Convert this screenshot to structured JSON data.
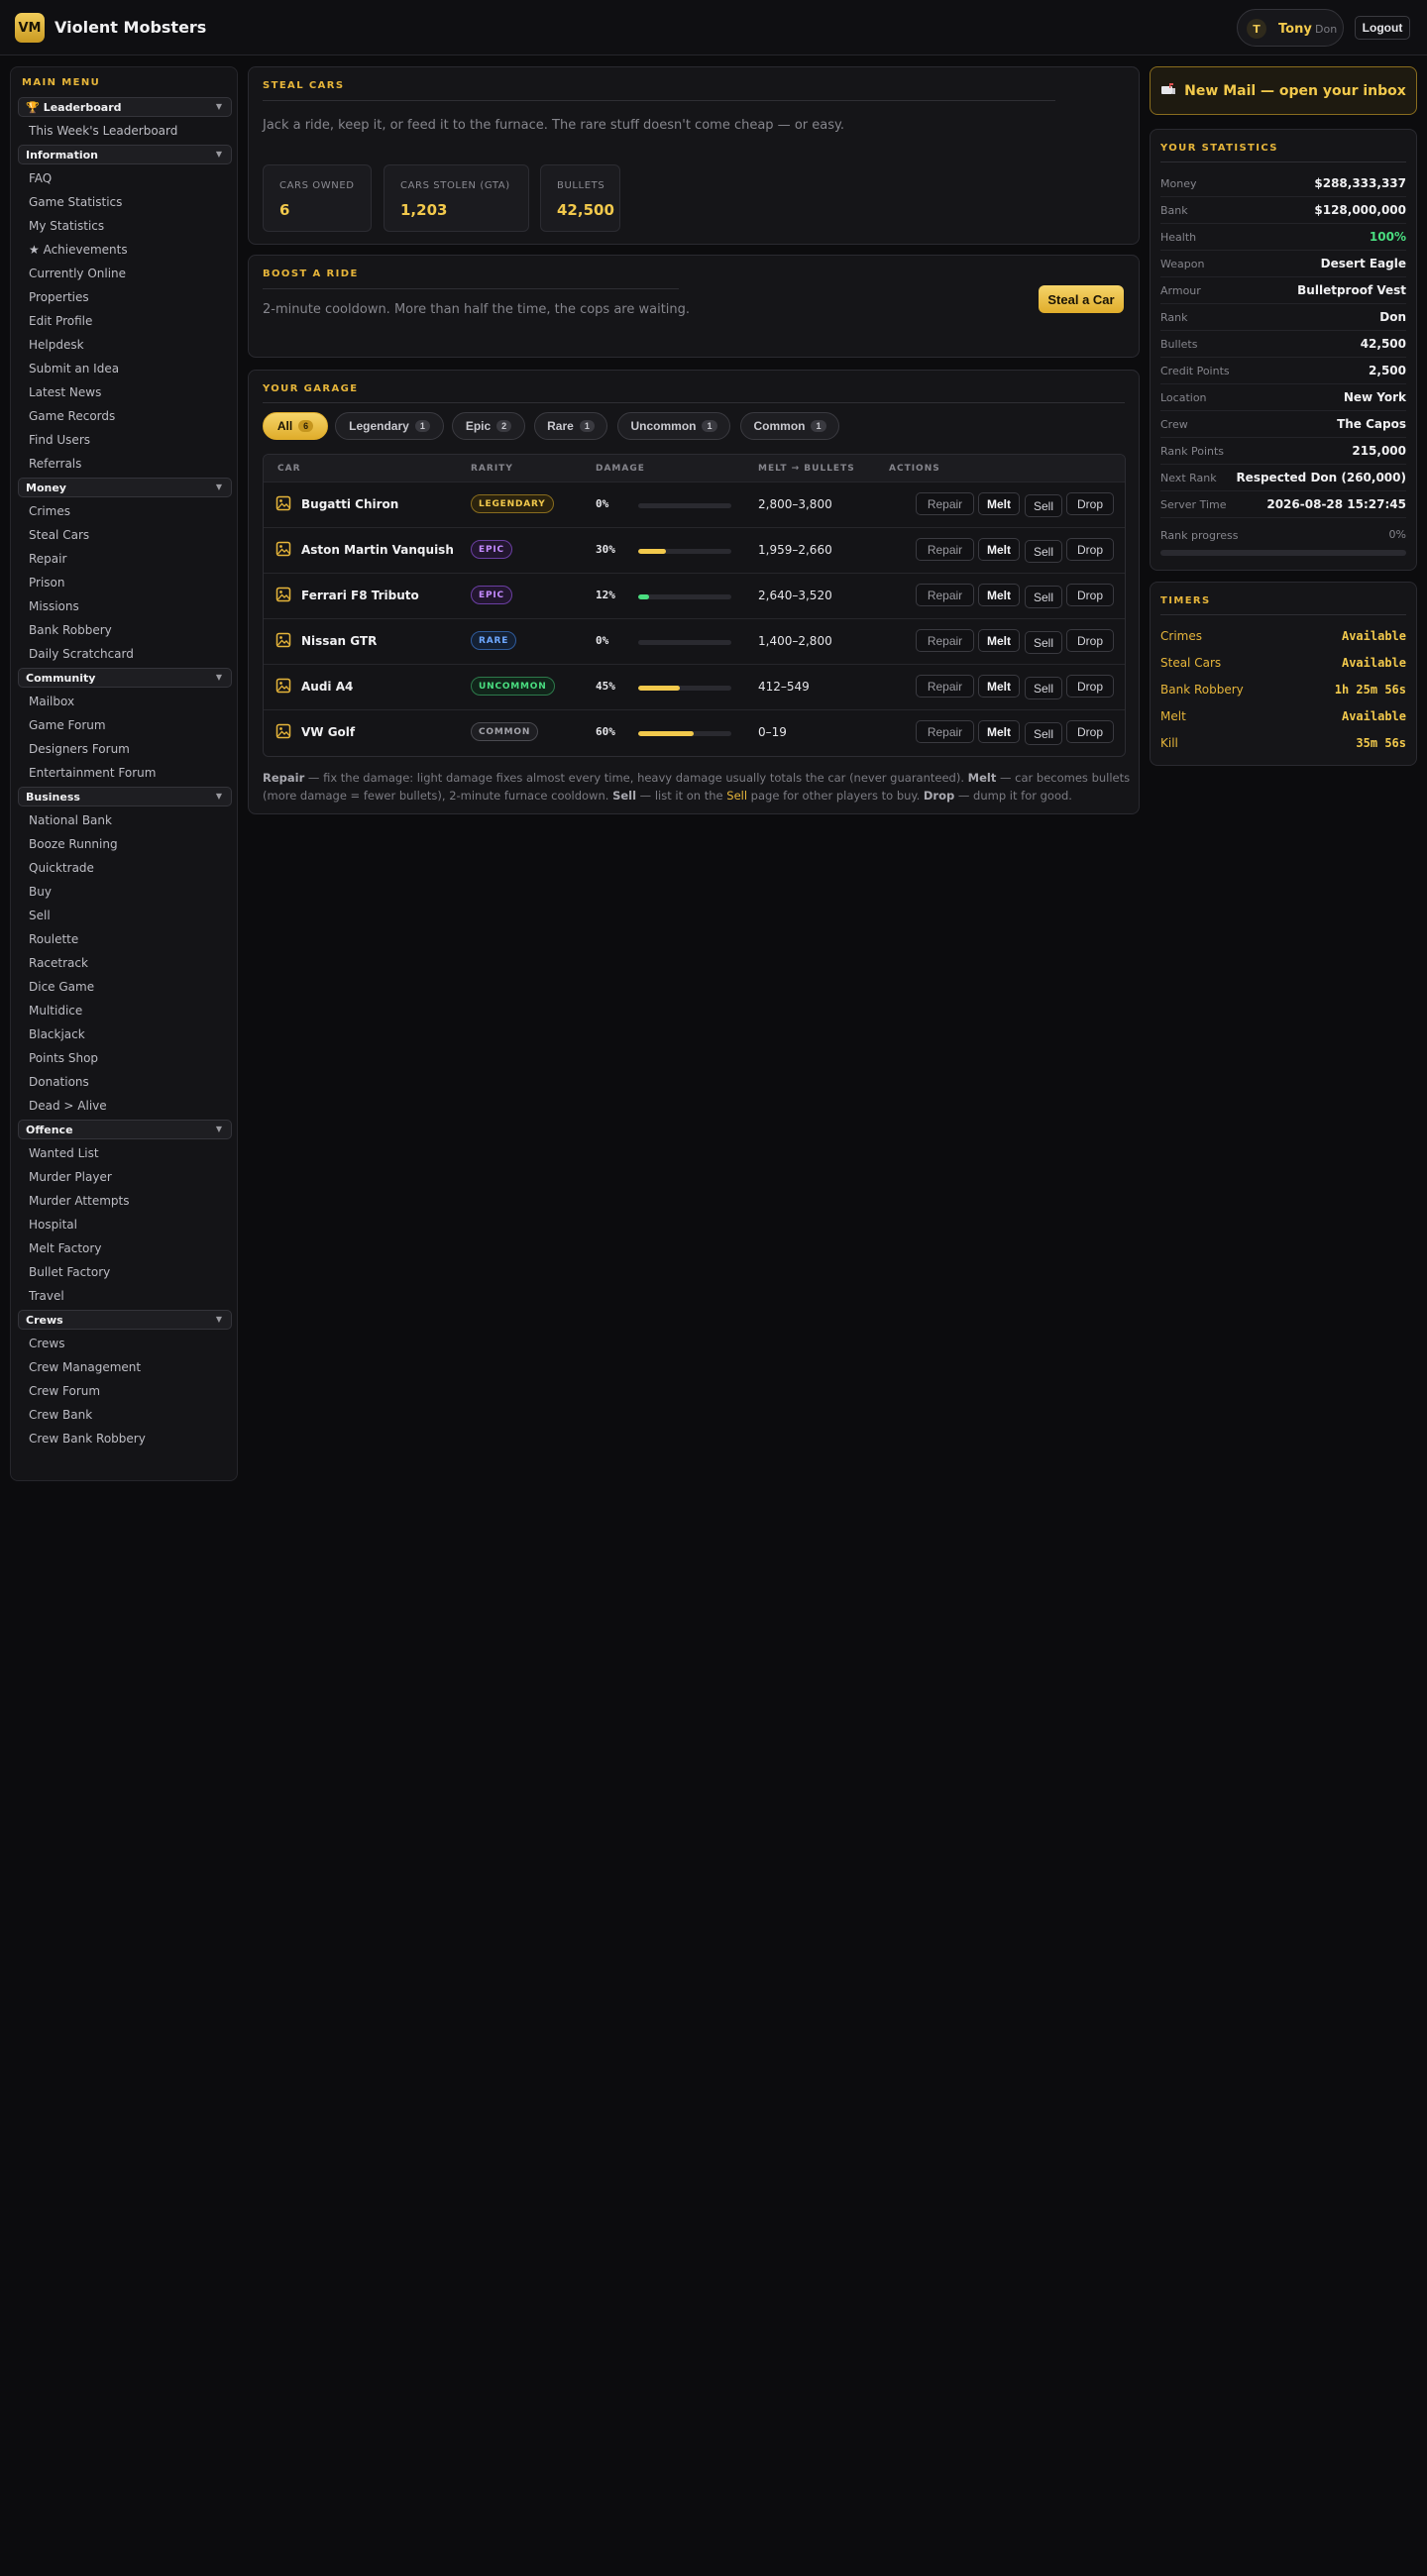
{
  "header": {
    "logo_initials": "VM",
    "brand": "Violent Mobsters",
    "user": {
      "initial": "T",
      "name": "Tony",
      "rank": "Don"
    },
    "logout_label": "Logout"
  },
  "sidebar": {
    "heading": "MAIN MENU",
    "sections": [
      {
        "title": "Leaderboard",
        "icon": "trophy-icon",
        "items": [
          "This Week's Leaderboard"
        ]
      },
      {
        "title": "Information",
        "items": [
          "FAQ",
          "Game Statistics",
          "My Statistics",
          "★ Achievements",
          "Currently Online",
          "Properties",
          "Edit Profile",
          "Helpdesk",
          "Submit an Idea",
          "Latest News",
          "Game Records",
          "Find Users",
          "Referrals"
        ]
      },
      {
        "title": "Money",
        "items": [
          "Crimes",
          "Steal Cars",
          "Repair",
          "Prison",
          "Missions",
          "Bank Robbery",
          "Daily Scratchcard"
        ]
      },
      {
        "title": "Community",
        "items": [
          "Mailbox",
          "Game Forum",
          "Designers Forum",
          "Entertainment Forum"
        ]
      },
      {
        "title": "Business",
        "items": [
          "National Bank",
          "Booze Running",
          "Quicktrade",
          "Buy",
          "Sell",
          "Roulette",
          "Racetrack",
          "Dice Game",
          "Multidice",
          "Blackjack",
          "Points Shop",
          "Donations",
          "Dead > Alive"
        ]
      },
      {
        "title": "Offence",
        "items": [
          "Wanted List",
          "Murder Player",
          "Murder Attempts",
          "Hospital",
          "Melt Factory",
          "Bullet Factory",
          "Travel"
        ]
      },
      {
        "title": "Crews",
        "items": [
          "Crews",
          "Crew Management",
          "Crew Forum",
          "Crew Bank",
          "Crew Bank Robbery"
        ]
      }
    ]
  },
  "steal_panel": {
    "title": "STEAL CARS",
    "intro": "Jack a ride, keep it, or feed it to the furnace. The rare stuff doesn't come cheap — or easy.",
    "stats": [
      {
        "label": "CARS OWNED",
        "value": "6"
      },
      {
        "label": "CARS STOLEN (GTA)",
        "value": "1,203"
      },
      {
        "label": "BULLETS",
        "value": "42,500"
      }
    ]
  },
  "boost_panel": {
    "title": "BOOST A RIDE",
    "text": "2-minute cooldown. More than half the time, the cops are waiting.",
    "button_label": "Steal a Car"
  },
  "garage": {
    "title": "YOUR GARAGE",
    "filters": [
      {
        "label": "All",
        "count": "6",
        "active": true
      },
      {
        "label": "Legendary",
        "count": "1",
        "active": false
      },
      {
        "label": "Epic",
        "count": "2",
        "active": false
      },
      {
        "label": "Rare",
        "count": "1",
        "active": false
      },
      {
        "label": "Uncommon",
        "count": "1",
        "active": false
      },
      {
        "label": "Common",
        "count": "1",
        "active": false
      }
    ],
    "columns": [
      "CAR",
      "RARITY",
      "DAMAGE",
      "MELT → BULLETS",
      "ACTIONS"
    ],
    "action_labels": {
      "repair": "Repair",
      "melt": "Melt",
      "sell": "Sell",
      "drop": "Drop"
    },
    "rows": [
      {
        "car": "Bugatti Chiron",
        "rarity": "LEGENDARY",
        "rarity_key": "legendary",
        "damage": 0,
        "damage_label": "0%",
        "melt": "2,800–3,800",
        "bar_color": "#f2c94c"
      },
      {
        "car": "Aston Martin Vanquish",
        "rarity": "EPIC",
        "rarity_key": "epic",
        "damage": 30,
        "damage_label": "30%",
        "melt": "1,959–2,660",
        "bar_color": "#f2c94c"
      },
      {
        "car": "Ferrari F8 Tributo",
        "rarity": "EPIC",
        "rarity_key": "epic",
        "damage": 12,
        "damage_label": "12%",
        "melt": "2,640–3,520",
        "bar_color": "#4ade80"
      },
      {
        "car": "Nissan GTR",
        "rarity": "RARE",
        "rarity_key": "rare",
        "damage": 0,
        "damage_label": "0%",
        "melt": "1,400–2,800",
        "bar_color": "#f2c94c"
      },
      {
        "car": "Audi A4",
        "rarity": "UNCOMMON",
        "rarity_key": "uncommon",
        "damage": 45,
        "damage_label": "45%",
        "melt": "412–549",
        "bar_color": "#f2c94c"
      },
      {
        "car": "VW Golf",
        "rarity": "COMMON",
        "rarity_key": "common",
        "damage": 60,
        "damage_label": "60%",
        "melt": "0–19",
        "bar_color": "#f2c94c"
      }
    ],
    "footnote": {
      "repair_label": "Repair",
      "repair_text": " — fix the damage: light damage fixes almost every time, heavy damage usually totals the car (never guaranteed). ",
      "melt_label": "Melt",
      "melt_text": " — car becomes bullets (more damage = fewer bullets), 2-minute furnace cooldown. ",
      "sell_label": "Sell",
      "sell_text_a": " — list it on the ",
      "sell_link": "Sell",
      "sell_text_b": " page for other players to buy. ",
      "drop_label": "Drop",
      "drop_text": " — dump it for good."
    }
  },
  "mail": {
    "icon": "mailbox-icon",
    "label": "New Mail — open your inbox"
  },
  "statistics": {
    "title": "YOUR STATISTICS",
    "rows": [
      {
        "label": "Money",
        "value": "$288,333,337",
        "color": "#f0f0f2"
      },
      {
        "label": "Bank",
        "value": "$128,000,000",
        "color": "#f0f0f2"
      },
      {
        "label": "Health",
        "value": "100%",
        "color": "#4ade80"
      },
      {
        "label": "Weapon",
        "value": "Desert Eagle",
        "color": "#f0f0f2"
      },
      {
        "label": "Armour",
        "value": "Bulletproof Vest",
        "color": "#f0f0f2"
      },
      {
        "label": "Rank",
        "value": "Don",
        "color": "#f0f0f2"
      },
      {
        "label": "Bullets",
        "value": "42,500",
        "color": "#f0f0f2"
      },
      {
        "label": "Credit Points",
        "value": "2,500",
        "color": "#f0f0f2"
      },
      {
        "label": "Location",
        "value": "New York",
        "color": "#f0f0f2"
      },
      {
        "label": "Crew",
        "value": "The Capos",
        "color": "#f0f0f2"
      },
      {
        "label": "Rank Points",
        "value": "215,000",
        "color": "#f0f0f2"
      },
      {
        "label": "Next Rank",
        "value": "Respected Don (260,000)",
        "color": "#f0f0f2"
      },
      {
        "label": "Server Time",
        "value": "2026-08-28 15:27:45",
        "color": "#f0f0f2"
      }
    ],
    "rank_progress_label": "Rank progress",
    "rank_progress_value": "0%",
    "rank_progress": 0
  },
  "timers": {
    "title": "TIMERS",
    "rows": [
      {
        "label": "Crimes",
        "value": "Available"
      },
      {
        "label": "Steal Cars",
        "value": "Available"
      },
      {
        "label": "Bank Robbery",
        "value": "1h 25m 56s"
      },
      {
        "label": "Melt",
        "value": "Available"
      },
      {
        "label": "Kill",
        "value": "35m 56s"
      }
    ]
  },
  "colors": {
    "accent": "#f2c94c",
    "background": "#0c0c0e",
    "panel": "#151518",
    "success": "#4ade80"
  }
}
